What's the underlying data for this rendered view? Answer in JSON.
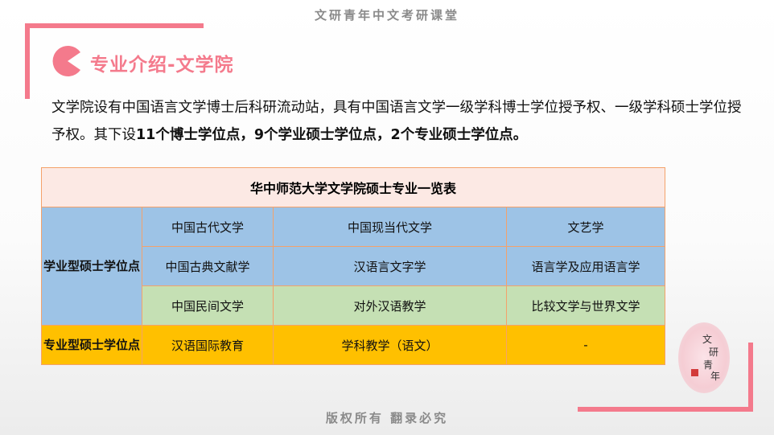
{
  "header": {
    "title": "文研青年中文考研课堂"
  },
  "section": {
    "title": "专业介绍-文学院"
  },
  "intro": {
    "text1": "文学院设有中国语言文学博士后科研流动站，具有中国语言文学一级学科博士学位授予权、一级学科硕士学位授予权。其下设",
    "bold1": "11个博士学位点，9个学业硕士学位点，2个专业硕士学位点。"
  },
  "table": {
    "caption": "华中师范大学文学院硕士专业一览表",
    "academic_label": "学业型硕士学位点",
    "academic_rows": [
      [
        "中国古代文学",
        "中国现当代文学",
        "文艺学"
      ],
      [
        "中国古典文献学",
        "汉语言文字学",
        "语言学及应用语言学"
      ],
      [
        "中国民间文学",
        "对外汉语教学",
        "比较文学与世界文学"
      ]
    ],
    "professional_label": "专业型硕士学位点",
    "professional_row": [
      "汉语国际教育",
      "学科教学（语文）",
      "-"
    ]
  },
  "seal": {
    "chars": [
      "文",
      "研",
      "青",
      "年"
    ]
  },
  "footer": {
    "title": "版权所有 翻录必究"
  },
  "colors": {
    "accent": "#f47a8c",
    "table_border": "#f4a26b",
    "caption_bg": "#fce9e4",
    "academic_bg": "#9dc3e6",
    "green_row_bg": "#c5e0b4",
    "professional_bg": "#ffc000"
  }
}
